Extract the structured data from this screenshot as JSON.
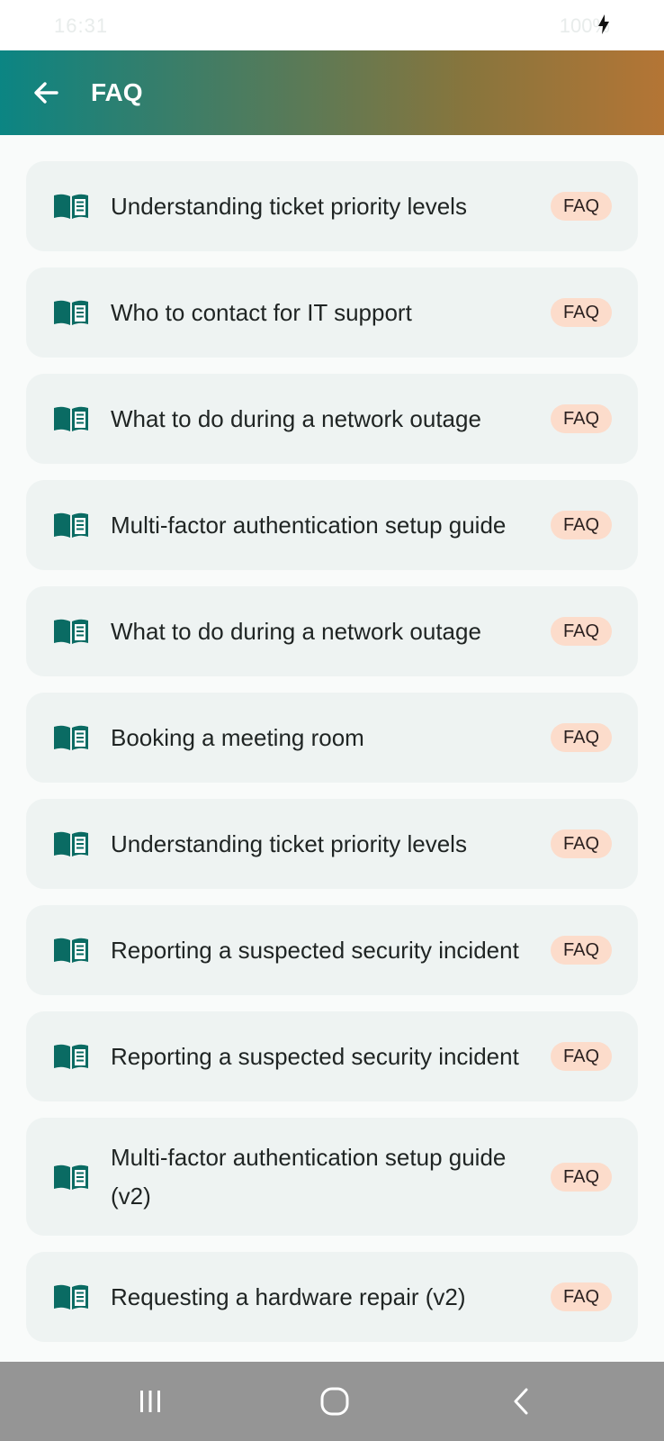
{
  "status_bar": {
    "time": "16:31",
    "right_text": "100%"
  },
  "app_bar": {
    "title": "FAQ",
    "back_icon": "arrow-left-icon"
  },
  "items": [
    {
      "title": "Understanding ticket priority levels",
      "badge": "FAQ",
      "icon": "book-icon"
    },
    {
      "title": "Who to contact for IT support",
      "badge": "FAQ",
      "icon": "book-icon"
    },
    {
      "title": "What to do during a network outage",
      "badge": "FAQ",
      "icon": "book-icon"
    },
    {
      "title": "Multi-factor authentication setup guide",
      "badge": "FAQ",
      "icon": "book-icon"
    },
    {
      "title": "What to do during a network outage",
      "badge": "FAQ",
      "icon": "book-icon"
    },
    {
      "title": "Booking a meeting room",
      "badge": "FAQ",
      "icon": "book-icon"
    },
    {
      "title": "Understanding ticket priority levels",
      "badge": "FAQ",
      "icon": "book-icon"
    },
    {
      "title": "Reporting a suspected security incident",
      "badge": "FAQ",
      "icon": "book-icon"
    },
    {
      "title": "Reporting a suspected security incident",
      "badge": "FAQ",
      "icon": "book-icon"
    },
    {
      "title": "Multi-factor authentication setup guide (v2)",
      "badge": "FAQ",
      "icon": "book-icon"
    },
    {
      "title": "Requesting a hardware repair (v2)",
      "badge": "FAQ",
      "icon": "book-icon"
    }
  ],
  "nav_bar": {
    "recents_icon": "recents-icon",
    "home_icon": "home-icon",
    "back_icon": "back-chevron-icon"
  },
  "colors": {
    "icon": "#0a6b63",
    "badge_bg": "#fcdccb",
    "card_bg": "#eef3f2",
    "app_bar_start": "#0b8583",
    "app_bar_end": "#b47535"
  }
}
